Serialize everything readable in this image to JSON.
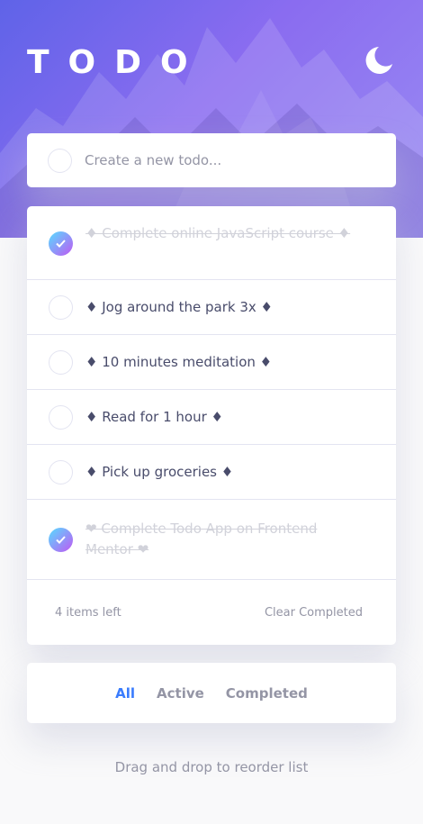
{
  "header": {
    "title": "TODO",
    "theme_icon": "moon-icon"
  },
  "create": {
    "placeholder": "Create a new todo..."
  },
  "todos": [
    {
      "text": "♦ Complete online JavaScript course ♦",
      "completed": true
    },
    {
      "text": "♦ Jog around the park 3x ♦",
      "completed": false
    },
    {
      "text": "♦ 10 minutes meditation ♦",
      "completed": false
    },
    {
      "text": "♦ Read for 1 hour ♦",
      "completed": false
    },
    {
      "text": "♦ Pick up groceries ♦",
      "completed": false
    },
    {
      "text": "❤ Complete Todo App on Frontend Mentor ❤",
      "completed": true
    }
  ],
  "footer": {
    "items_left": "4 items left",
    "clear_label": "Clear Completed"
  },
  "filters": {
    "all": "All",
    "active": "Active",
    "completed": "Completed",
    "selected": "All"
  },
  "hint": "Drag and drop to reorder list",
  "colors": {
    "accent": "#3a7cfd",
    "check_gradient_start": "#57ddff",
    "check_gradient_end": "#c058f3",
    "hero_start": "#5f63e8",
    "hero_end": "#9a8cf3"
  }
}
